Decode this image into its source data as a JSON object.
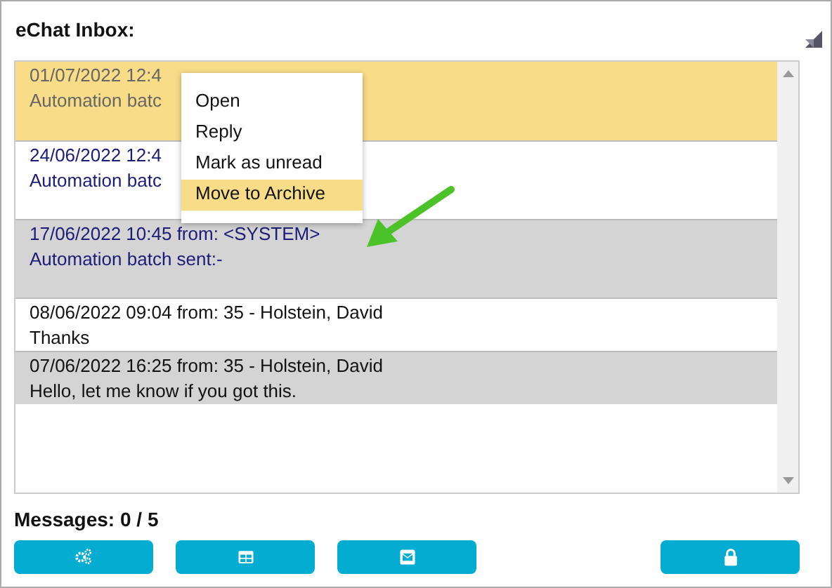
{
  "panel": {
    "title": "eChat Inbox:"
  },
  "messages": [
    {
      "header": "01/07/2022 12:4",
      "body": "Automation batc",
      "selected": true,
      "unread": false
    },
    {
      "header": "24/06/2022 12:4",
      "body": "Automation batc",
      "selected": false,
      "unread": true
    },
    {
      "header": "17/06/2022 10:45 from: <SYSTEM>",
      "body": "Automation batch sent:-",
      "selected": false,
      "unread": true
    },
    {
      "header": "08/06/2022 09:04 from: 35 - Holstein, David",
      "body": "Thanks",
      "selected": false,
      "unread": false
    },
    {
      "header": "07/06/2022 16:25 from: 35 - Holstein, David",
      "body": "Hello, let me know if you got this.",
      "selected": false,
      "unread": false
    }
  ],
  "context_menu": [
    {
      "label": "Open",
      "selected": false
    },
    {
      "label": "Reply",
      "selected": false
    },
    {
      "label": "Mark as unread",
      "selected": false
    },
    {
      "label": "Move to Archive",
      "selected": true
    }
  ],
  "status": "Messages: 0 / 5",
  "buttons": [
    {
      "kind": "gears"
    },
    {
      "kind": "grid"
    },
    {
      "kind": "mail"
    },
    {
      "kind": "lock"
    }
  ]
}
